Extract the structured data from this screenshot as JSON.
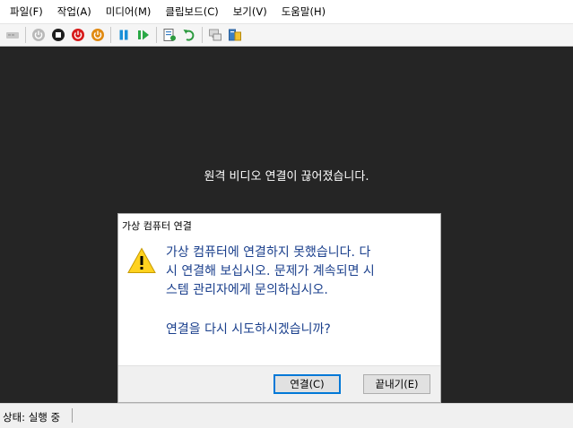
{
  "menu": [
    "파일(F)",
    "작업(A)",
    "미디어(M)",
    "클립보드(C)",
    "보기(V)",
    "도움말(H)"
  ],
  "toolbar": {
    "icons": [
      "ctrl-alt-del-icon",
      "start-icon",
      "turn-off-icon",
      "shut-down-icon",
      "save-icon",
      "pause-icon",
      "reset-icon",
      "checkpoint-icon",
      "revert-icon",
      "enhanced-session-icon",
      "share-icon"
    ]
  },
  "screen": {
    "message": "원격 비디오 연결이 끊어졌습니다."
  },
  "dialog": {
    "title": "가상 컴퓨터 연결",
    "message": "가상 컴퓨터에 연결하지 못했습니다. 다\n시 연결해 보십시오. 문제가 계속되면 시\n스템 관리자에게 문의하십시오.",
    "question": "연결을 다시 시도하시겠습니까?",
    "ok_label": "연결(C)",
    "cancel_label": "끝내기(E)"
  },
  "status": {
    "text": "상태: 실행 중"
  },
  "colors": {
    "screen_bg": "#252525",
    "dialog_text": "#1a3f8c",
    "accent": "#0078d7"
  }
}
